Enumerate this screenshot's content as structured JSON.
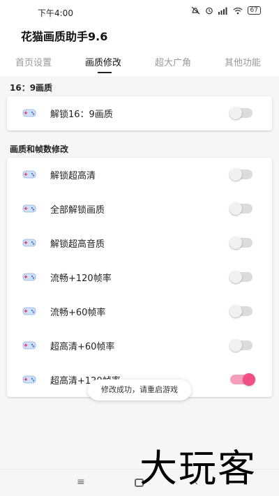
{
  "status_bar": {
    "time": "下午4:00",
    "icons": [
      "mute-icon",
      "alarm-icon",
      "signal-icon",
      "wifi-icon"
    ],
    "battery": "67"
  },
  "app": {
    "title": "花猫画质助手9.6"
  },
  "tabs": [
    {
      "label": "首页设置",
      "active": false
    },
    {
      "label": "画质修改",
      "active": true
    },
    {
      "label": "超大广角",
      "active": false
    },
    {
      "label": "其他功能",
      "active": false
    }
  ],
  "sections": [
    {
      "title": "16：9画质",
      "items": [
        {
          "label": "解锁16：9画质",
          "on": false
        }
      ]
    },
    {
      "title": "画质和帧数修改",
      "items": [
        {
          "label": "解锁超高清",
          "on": false
        },
        {
          "label": "全部解锁画质",
          "on": false
        },
        {
          "label": "解锁超高音质",
          "on": false
        },
        {
          "label": "流畅+120帧率",
          "on": false
        },
        {
          "label": "流畅+60帧率",
          "on": false
        },
        {
          "label": "超高清+60帧率",
          "on": false
        },
        {
          "label": "超高清+120帧率",
          "on": true
        }
      ]
    }
  ],
  "toast": "修改成功，请重启游戏",
  "nav": {
    "menu_glyph": "≡",
    "back_glyph": "‹"
  },
  "watermark": "大玩客",
  "colors": {
    "accent": "#ef4f83",
    "accent_track": "#f5a0bb",
    "toggle_off": "#dcdcdc"
  }
}
